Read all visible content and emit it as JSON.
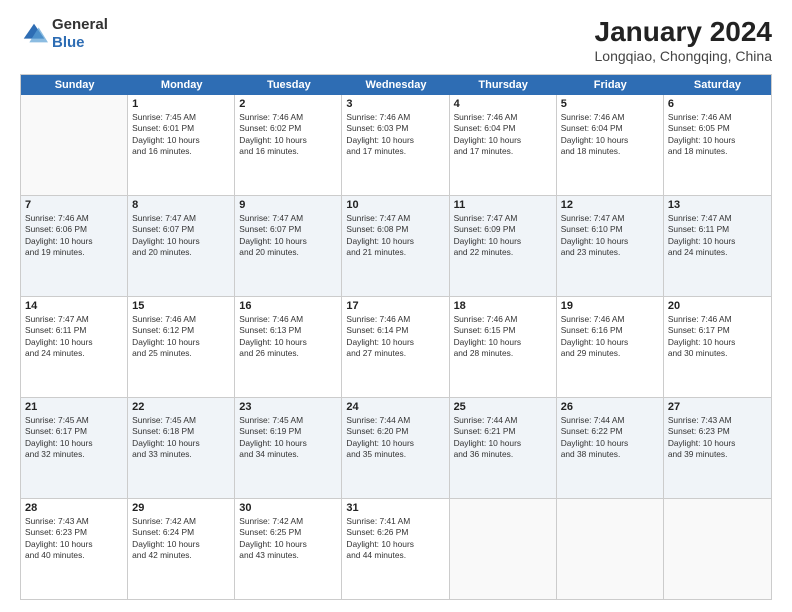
{
  "logo": {
    "general": "General",
    "blue": "Blue"
  },
  "header": {
    "title": "January 2024",
    "location": "Longqiao, Chongqing, China"
  },
  "days": [
    "Sunday",
    "Monday",
    "Tuesday",
    "Wednesday",
    "Thursday",
    "Friday",
    "Saturday"
  ],
  "weeks": [
    [
      {
        "num": "",
        "lines": [],
        "empty": true
      },
      {
        "num": "1",
        "lines": [
          "Sunrise: 7:45 AM",
          "Sunset: 6:01 PM",
          "Daylight: 10 hours",
          "and 16 minutes."
        ]
      },
      {
        "num": "2",
        "lines": [
          "Sunrise: 7:46 AM",
          "Sunset: 6:02 PM",
          "Daylight: 10 hours",
          "and 16 minutes."
        ]
      },
      {
        "num": "3",
        "lines": [
          "Sunrise: 7:46 AM",
          "Sunset: 6:03 PM",
          "Daylight: 10 hours",
          "and 17 minutes."
        ]
      },
      {
        "num": "4",
        "lines": [
          "Sunrise: 7:46 AM",
          "Sunset: 6:04 PM",
          "Daylight: 10 hours",
          "and 17 minutes."
        ]
      },
      {
        "num": "5",
        "lines": [
          "Sunrise: 7:46 AM",
          "Sunset: 6:04 PM",
          "Daylight: 10 hours",
          "and 18 minutes."
        ]
      },
      {
        "num": "6",
        "lines": [
          "Sunrise: 7:46 AM",
          "Sunset: 6:05 PM",
          "Daylight: 10 hours",
          "and 18 minutes."
        ]
      }
    ],
    [
      {
        "num": "7",
        "lines": [
          "Sunrise: 7:46 AM",
          "Sunset: 6:06 PM",
          "Daylight: 10 hours",
          "and 19 minutes."
        ]
      },
      {
        "num": "8",
        "lines": [
          "Sunrise: 7:47 AM",
          "Sunset: 6:07 PM",
          "Daylight: 10 hours",
          "and 20 minutes."
        ]
      },
      {
        "num": "9",
        "lines": [
          "Sunrise: 7:47 AM",
          "Sunset: 6:07 PM",
          "Daylight: 10 hours",
          "and 20 minutes."
        ]
      },
      {
        "num": "10",
        "lines": [
          "Sunrise: 7:47 AM",
          "Sunset: 6:08 PM",
          "Daylight: 10 hours",
          "and 21 minutes."
        ]
      },
      {
        "num": "11",
        "lines": [
          "Sunrise: 7:47 AM",
          "Sunset: 6:09 PM",
          "Daylight: 10 hours",
          "and 22 minutes."
        ]
      },
      {
        "num": "12",
        "lines": [
          "Sunrise: 7:47 AM",
          "Sunset: 6:10 PM",
          "Daylight: 10 hours",
          "and 23 minutes."
        ]
      },
      {
        "num": "13",
        "lines": [
          "Sunrise: 7:47 AM",
          "Sunset: 6:11 PM",
          "Daylight: 10 hours",
          "and 24 minutes."
        ]
      }
    ],
    [
      {
        "num": "14",
        "lines": [
          "Sunrise: 7:47 AM",
          "Sunset: 6:11 PM",
          "Daylight: 10 hours",
          "and 24 minutes."
        ]
      },
      {
        "num": "15",
        "lines": [
          "Sunrise: 7:46 AM",
          "Sunset: 6:12 PM",
          "Daylight: 10 hours",
          "and 25 minutes."
        ]
      },
      {
        "num": "16",
        "lines": [
          "Sunrise: 7:46 AM",
          "Sunset: 6:13 PM",
          "Daylight: 10 hours",
          "and 26 minutes."
        ]
      },
      {
        "num": "17",
        "lines": [
          "Sunrise: 7:46 AM",
          "Sunset: 6:14 PM",
          "Daylight: 10 hours",
          "and 27 minutes."
        ]
      },
      {
        "num": "18",
        "lines": [
          "Sunrise: 7:46 AM",
          "Sunset: 6:15 PM",
          "Daylight: 10 hours",
          "and 28 minutes."
        ]
      },
      {
        "num": "19",
        "lines": [
          "Sunrise: 7:46 AM",
          "Sunset: 6:16 PM",
          "Daylight: 10 hours",
          "and 29 minutes."
        ]
      },
      {
        "num": "20",
        "lines": [
          "Sunrise: 7:46 AM",
          "Sunset: 6:17 PM",
          "Daylight: 10 hours",
          "and 30 minutes."
        ]
      }
    ],
    [
      {
        "num": "21",
        "lines": [
          "Sunrise: 7:45 AM",
          "Sunset: 6:17 PM",
          "Daylight: 10 hours",
          "and 32 minutes."
        ]
      },
      {
        "num": "22",
        "lines": [
          "Sunrise: 7:45 AM",
          "Sunset: 6:18 PM",
          "Daylight: 10 hours",
          "and 33 minutes."
        ]
      },
      {
        "num": "23",
        "lines": [
          "Sunrise: 7:45 AM",
          "Sunset: 6:19 PM",
          "Daylight: 10 hours",
          "and 34 minutes."
        ]
      },
      {
        "num": "24",
        "lines": [
          "Sunrise: 7:44 AM",
          "Sunset: 6:20 PM",
          "Daylight: 10 hours",
          "and 35 minutes."
        ]
      },
      {
        "num": "25",
        "lines": [
          "Sunrise: 7:44 AM",
          "Sunset: 6:21 PM",
          "Daylight: 10 hours",
          "and 36 minutes."
        ]
      },
      {
        "num": "26",
        "lines": [
          "Sunrise: 7:44 AM",
          "Sunset: 6:22 PM",
          "Daylight: 10 hours",
          "and 38 minutes."
        ]
      },
      {
        "num": "27",
        "lines": [
          "Sunrise: 7:43 AM",
          "Sunset: 6:23 PM",
          "Daylight: 10 hours",
          "and 39 minutes."
        ]
      }
    ],
    [
      {
        "num": "28",
        "lines": [
          "Sunrise: 7:43 AM",
          "Sunset: 6:23 PM",
          "Daylight: 10 hours",
          "and 40 minutes."
        ]
      },
      {
        "num": "29",
        "lines": [
          "Sunrise: 7:42 AM",
          "Sunset: 6:24 PM",
          "Daylight: 10 hours",
          "and 42 minutes."
        ]
      },
      {
        "num": "30",
        "lines": [
          "Sunrise: 7:42 AM",
          "Sunset: 6:25 PM",
          "Daylight: 10 hours",
          "and 43 minutes."
        ]
      },
      {
        "num": "31",
        "lines": [
          "Sunrise: 7:41 AM",
          "Sunset: 6:26 PM",
          "Daylight: 10 hours",
          "and 44 minutes."
        ]
      },
      {
        "num": "",
        "lines": [],
        "empty": true
      },
      {
        "num": "",
        "lines": [],
        "empty": true
      },
      {
        "num": "",
        "lines": [],
        "empty": true
      }
    ]
  ]
}
